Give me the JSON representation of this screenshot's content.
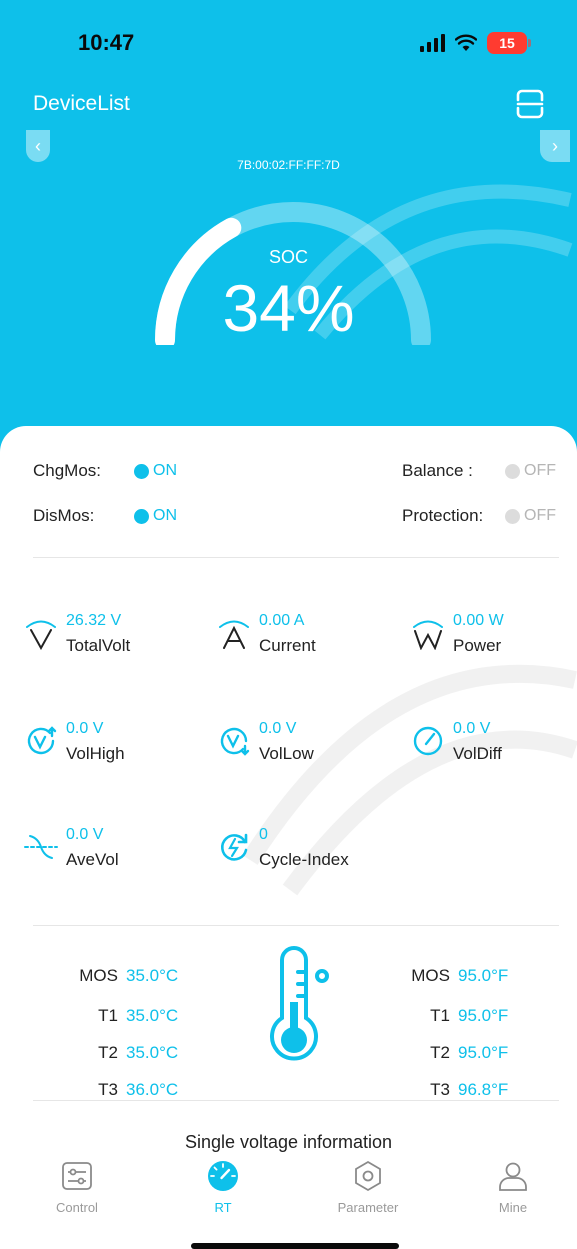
{
  "status_bar": {
    "time": "10:47",
    "battery": "15"
  },
  "header": {
    "title": "DeviceList",
    "device_mac": "7B:00:02:FF:FF:7D",
    "soc_label": "SOC",
    "soc_value": "34%",
    "soc_percent": 34
  },
  "switches": {
    "chg_mos": {
      "label": "ChgMos:",
      "state": "ON"
    },
    "dis_mos": {
      "label": "DisMos:",
      "state": "ON"
    },
    "balance": {
      "label": "Balance :",
      "state": "OFF"
    },
    "protection": {
      "label": "Protection:",
      "state": "OFF"
    }
  },
  "metrics": [
    {
      "value": "26.32 V",
      "label": "TotalVolt",
      "icon": "voltage-icon"
    },
    {
      "value": "0.00 A",
      "label": "Current",
      "icon": "current-icon"
    },
    {
      "value": "0.00 W",
      "label": "Power",
      "icon": "power-icon"
    },
    {
      "value": "0.0 V",
      "label": "VolHigh",
      "icon": "voltage-high-icon"
    },
    {
      "value": "0.0 V",
      "label": "VolLow",
      "icon": "voltage-low-icon"
    },
    {
      "value": "0.0 V",
      "label": "VolDiff",
      "icon": "voltage-diff-gauge-icon"
    },
    {
      "value": "0.0 V",
      "label": "AveVol",
      "icon": "average-voltage-icon"
    },
    {
      "value": "0",
      "label": "Cycle-Index",
      "icon": "cycle-icon"
    }
  ],
  "temperatures": {
    "celsius": [
      {
        "label": "MOS",
        "value": "35.0°C"
      },
      {
        "label": "T1",
        "value": "35.0°C"
      },
      {
        "label": "T2",
        "value": "35.0°C"
      },
      {
        "label": "T3",
        "value": "36.0°C"
      }
    ],
    "fahrenheit": [
      {
        "label": "MOS",
        "value": "95.0°F"
      },
      {
        "label": "T1",
        "value": "95.0°F"
      },
      {
        "label": "T2",
        "value": "95.0°F"
      },
      {
        "label": "T3",
        "value": "96.8°F"
      }
    ]
  },
  "section_title": "Single voltage information",
  "tabs": [
    {
      "label": "Control",
      "icon": "sliders-icon"
    },
    {
      "label": "RT",
      "icon": "gauge-icon",
      "active": true
    },
    {
      "label": "Parameter",
      "icon": "hex-nut-icon"
    },
    {
      "label": "Mine",
      "icon": "person-icon"
    }
  ],
  "colors": {
    "accent": "#0ec0ea",
    "off": "#dcdcdc"
  }
}
